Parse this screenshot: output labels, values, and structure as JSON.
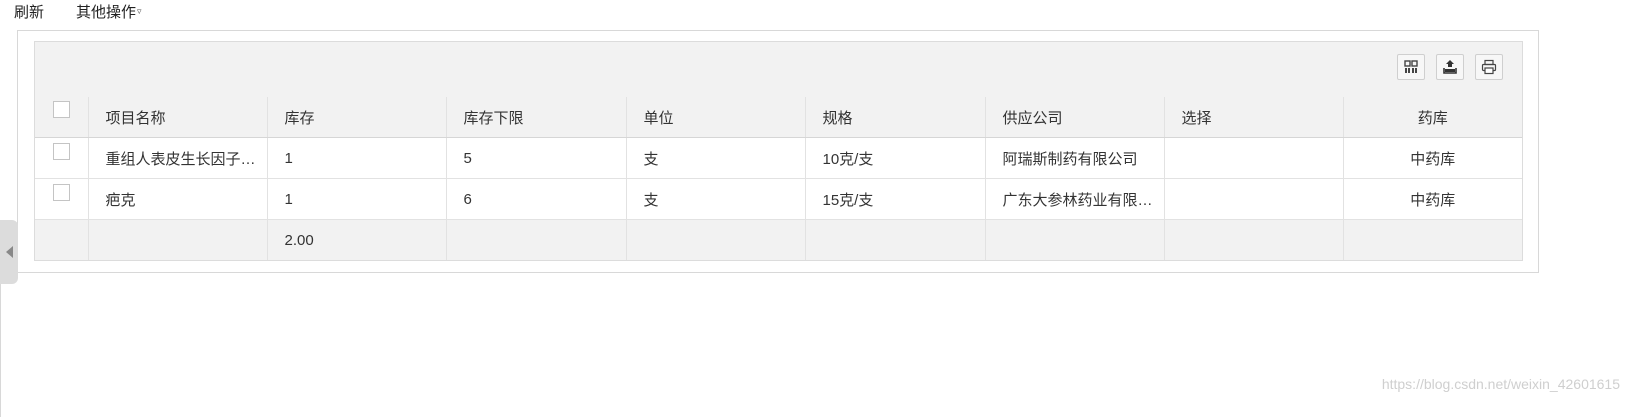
{
  "toolbar": {
    "refresh_label": "刷新",
    "more_label": "其他操作",
    "more_caret": "▿"
  },
  "grid_tools": [
    {
      "icon": "columns-icon"
    },
    {
      "icon": "export-icon"
    },
    {
      "icon": "print-icon"
    }
  ],
  "table": {
    "headers": [
      "项目名称",
      "库存",
      "库存下限",
      "单位",
      "规格",
      "供应公司",
      "选择",
      "药库"
    ],
    "rows": [
      [
        "重组人表皮生长因子凝胶",
        "1",
        "5",
        "支",
        "10克/支",
        "阿瑞斯制药有限公司",
        "",
        "中药库"
      ],
      [
        "疤克",
        "1",
        "6",
        "支",
        "15克/支",
        "广东大参林药业有限公司",
        "",
        "中药库"
      ]
    ],
    "footer_total": "2.00"
  },
  "watermark": "https://blog.csdn.net/weixin_42601615",
  "colors": {
    "header_bg": "#f2f2f2",
    "border": "#e2e2e2",
    "text": "#333333"
  }
}
